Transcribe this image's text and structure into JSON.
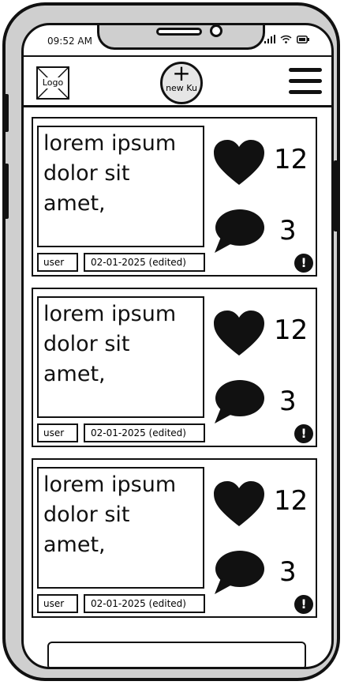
{
  "status_bar": {
    "time": "09:52 AM"
  },
  "header": {
    "logo_label": "Logo",
    "new_button_symbol": "+",
    "new_button_label": "new Ku",
    "menu_icon": "hamburger-menu-icon"
  },
  "posts": [
    {
      "text": "lorem ipsum dolor sit amet,",
      "user": "user",
      "date": "02-01-2025 (edited)",
      "likes": "12",
      "comments": "3",
      "alert": "!"
    },
    {
      "text": "lorem ipsum dolor sit amet,",
      "user": "user",
      "date": "02-01-2025 (edited)",
      "likes": "12",
      "comments": "3",
      "alert": "!"
    },
    {
      "text": "lorem ipsum dolor sit amet,",
      "user": "user",
      "date": "02-01-2025 (edited)",
      "likes": "12",
      "comments": "3",
      "alert": "!"
    }
  ],
  "bottom_input": {
    "value": ""
  },
  "colors": {
    "ink": "#111111",
    "frame": "#cfcfcf",
    "button_fill": "#e6e6e6"
  }
}
